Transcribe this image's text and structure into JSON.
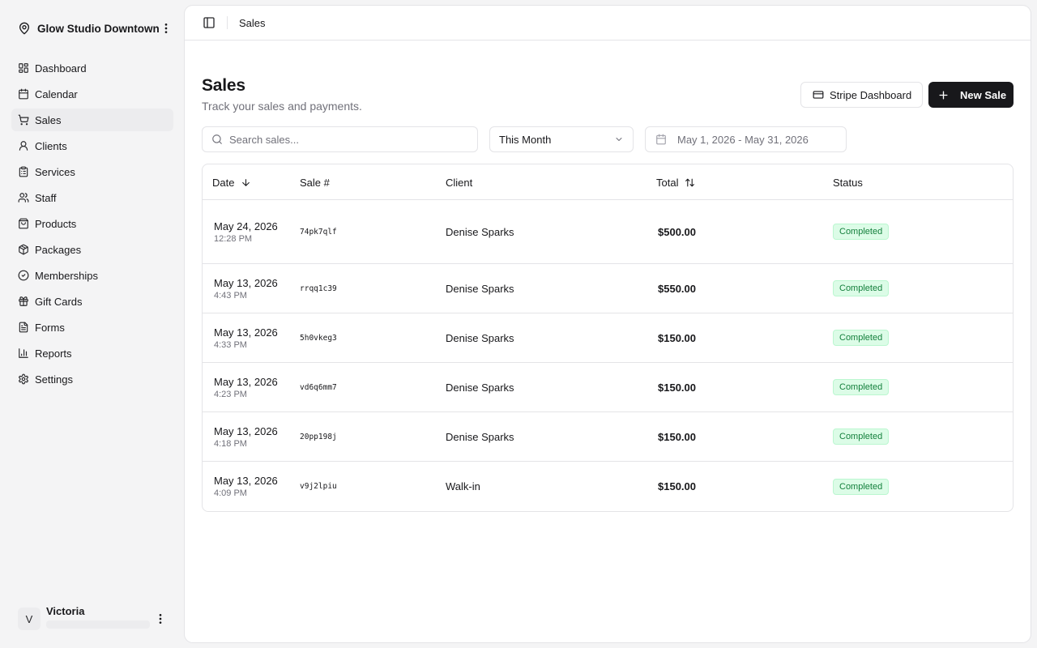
{
  "workspace": {
    "name": "Glow Studio Downtown"
  },
  "sidebar": {
    "items": [
      {
        "label": "Dashboard",
        "icon": "dashboard-icon"
      },
      {
        "label": "Calendar",
        "icon": "calendar-icon"
      },
      {
        "label": "Sales",
        "icon": "cart-icon",
        "active": true
      },
      {
        "label": "Clients",
        "icon": "user-icon"
      },
      {
        "label": "Services",
        "icon": "clipboard-icon"
      },
      {
        "label": "Staff",
        "icon": "users-icon"
      },
      {
        "label": "Products",
        "icon": "bag-icon"
      },
      {
        "label": "Packages",
        "icon": "package-icon"
      },
      {
        "label": "Memberships",
        "icon": "badge-check-icon"
      },
      {
        "label": "Gift Cards",
        "icon": "gift-icon"
      },
      {
        "label": "Forms",
        "icon": "file-text-icon"
      },
      {
        "label": "Reports",
        "icon": "bar-chart-icon"
      },
      {
        "label": "Settings",
        "icon": "gear-icon"
      }
    ]
  },
  "user": {
    "initial": "V",
    "name": "Victoria"
  },
  "topbar": {
    "breadcrumb": "Sales"
  },
  "page": {
    "title": "Sales",
    "subtitle": "Track your sales and payments."
  },
  "actions": {
    "stripe_label": "Stripe Dashboard",
    "new_sale_label": "New Sale"
  },
  "filters": {
    "search_placeholder": "Search sales...",
    "period": "This Month",
    "date_range": "May 1, 2026 - May 31, 2026"
  },
  "table": {
    "columns": {
      "date": "Date",
      "sale_no": "Sale #",
      "client": "Client",
      "total": "Total",
      "status": "Status"
    },
    "rows": [
      {
        "date": "May 24, 2026",
        "time": "12:28 PM",
        "sale_no": "74pk7qlf",
        "client": "Denise Sparks",
        "total": "$500.00",
        "status": "Completed"
      },
      {
        "date": "May 13, 2026",
        "time": "4:43 PM",
        "sale_no": "rrqq1c39",
        "client": "Denise Sparks",
        "total": "$550.00",
        "status": "Completed"
      },
      {
        "date": "May 13, 2026",
        "time": "4:33 PM",
        "sale_no": "5h0vkeg3",
        "client": "Denise Sparks",
        "total": "$150.00",
        "status": "Completed"
      },
      {
        "date": "May 13, 2026",
        "time": "4:23 PM",
        "sale_no": "vd6q6mm7",
        "client": "Denise Sparks",
        "total": "$150.00",
        "status": "Completed"
      },
      {
        "date": "May 13, 2026",
        "time": "4:18 PM",
        "sale_no": "20pp198j",
        "client": "Denise Sparks",
        "total": "$150.00",
        "status": "Completed"
      },
      {
        "date": "May 13, 2026",
        "time": "4:09 PM",
        "sale_no": "v9j2lpiu",
        "client": "Walk-in",
        "total": "$150.00",
        "status": "Completed"
      }
    ]
  },
  "colors": {
    "accent": "#18181b",
    "status_completed_bg": "#dcfce7",
    "status_completed_text": "#15803d"
  }
}
